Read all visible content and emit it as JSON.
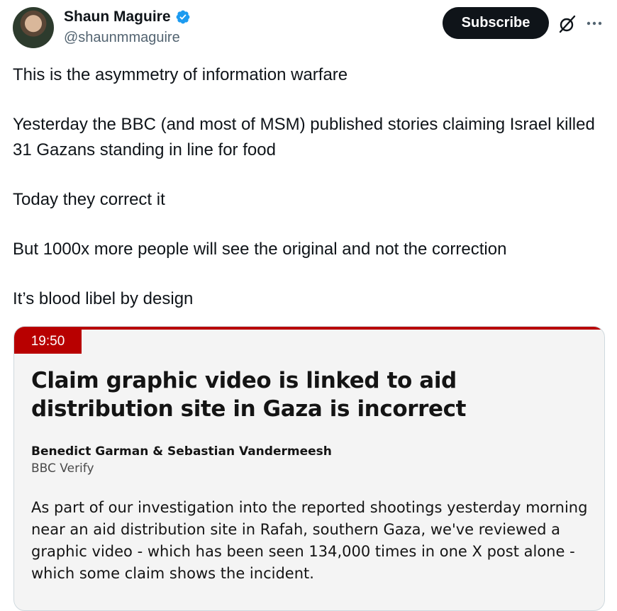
{
  "author": {
    "display_name": "Shaun Maguire",
    "handle": "@shaunmmaguire",
    "verified": true,
    "verified_color": "#1d9bf0"
  },
  "header": {
    "subscribe_label": "Subscribe",
    "grok_icon": "grok-icon",
    "more_icon": "more-icon"
  },
  "tweet": {
    "paragraphs": [
      "This is the asymmetry of information warfare",
      "Yesterday the BBC (and most of MSM) published stories claiming Israel killed 31 Gazans standing in line for food",
      "Today they correct it",
      "But 1000x more people will see the original and not the correction",
      "It’s blood libel by design"
    ]
  },
  "card": {
    "time": "19:50",
    "accent_color": "#b80000",
    "headline": "Claim graphic video is linked to aid distribution site in Gaza is incorrect",
    "authors": "Benedict Garman & Sebastian Vandermeesh",
    "source": "BBC Verify",
    "body": "As part of our investigation into the reported shootings yesterday morning near an aid distribution site in Rafah, southern Gaza, we've reviewed a graphic video - which has been seen 134,000 times in one X post alone - which some claim shows the incident."
  }
}
